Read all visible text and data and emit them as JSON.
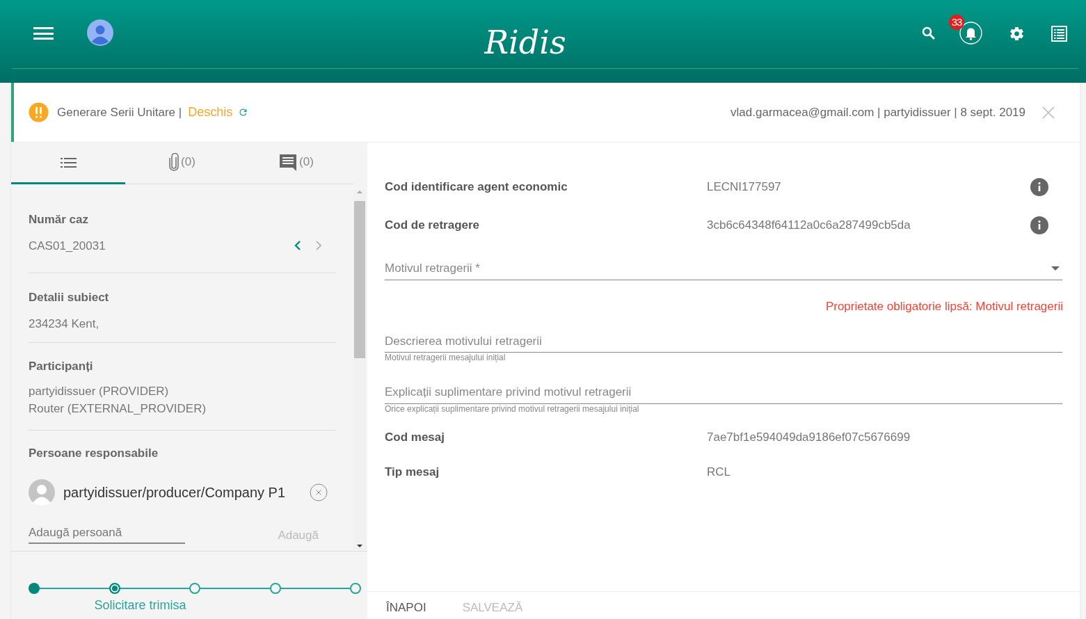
{
  "header": {
    "logo": "Ridis",
    "notification_count": "33"
  },
  "case_bar": {
    "process": "Generare Serii Unitare |",
    "status": "Deschis",
    "meta": "vlad.garmacea@gmail.com | partyidissuer | 8 sept. 2019"
  },
  "side_tabs": [
    {
      "kind": "list",
      "selected": true
    },
    {
      "kind": "attachments",
      "count": "(0)",
      "selected": false
    },
    {
      "kind": "comments",
      "count": "(0)",
      "selected": false
    }
  ],
  "case_number": {
    "label": "Număr caz",
    "value": "CAS01_20031",
    "prev_disabled": false,
    "next_disabled": true
  },
  "subject": {
    "label": "Detalii subiect",
    "value": "234234 Kent,"
  },
  "participants": {
    "label": "Participanți",
    "items": [
      "partyidissuer (PROVIDER)",
      "Router (EXTERNAL_PROVIDER)"
    ]
  },
  "responsible": {
    "label": "Persoane responsabile",
    "people": [
      "partyidissuer/producer/Company P1"
    ],
    "add_placeholder": "Adaugă persoană",
    "add_button": "Adaugă",
    "add_disabled": true
  },
  "stepper": [
    {
      "kind": "done"
    },
    {
      "kind": "current",
      "label": "Solicitare trimisa"
    },
    {
      "kind": "pending"
    },
    {
      "kind": "pending"
    },
    {
      "kind": "pending"
    }
  ],
  "form": [
    {
      "kind": "readonly",
      "label": "Cod identificare agent economic",
      "value": "LECNI177597",
      "info": true
    },
    {
      "kind": "readonly",
      "label": "Cod de retragere",
      "value": "3cb6c64348f64112a0c6a287499cb5da",
      "info": true
    },
    {
      "kind": "select",
      "placeholder": "Motivul retragerii *",
      "error": "Proprietate obligatorie lipsă: Motivul retragerii"
    },
    {
      "kind": "text",
      "placeholder": "Descrierea motivului retragerii",
      "hint": "Motivul retragerii mesajului inițial"
    },
    {
      "kind": "text",
      "placeholder": "Explicații suplimentare privind motivul retragerii",
      "hint": "Orice explicații suplimentare privind motivul retragerii mesajului inițial"
    },
    {
      "kind": "readonly",
      "label": "Cod mesaj",
      "value": "7ae7bf1e594049da9186ef07c5676699",
      "info": false
    },
    {
      "kind": "readonly",
      "label": "Tip mesaj",
      "value": "RCL",
      "info": false
    }
  ],
  "actions": [
    {
      "label": "ÎNAPOI",
      "disabled": false
    },
    {
      "label": "SALVEAZĂ",
      "disabled": true
    }
  ]
}
